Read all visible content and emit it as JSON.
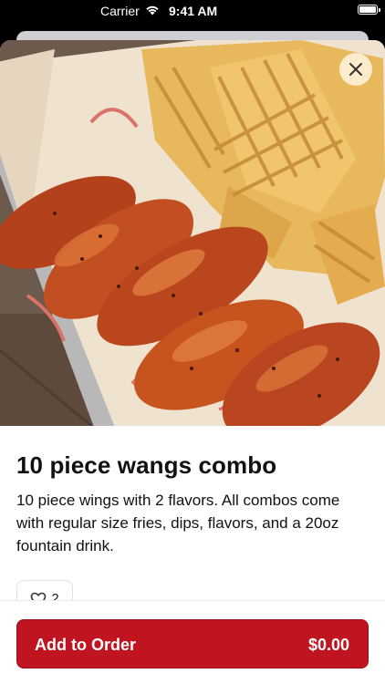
{
  "status_bar": {
    "carrier": "Carrier",
    "time": "9:41 AM",
    "icons": [
      "wifi-icon",
      "battery-icon"
    ]
  },
  "item": {
    "title": "10 piece wangs combo",
    "description": "10 piece wings with 2 flavors. All combos come with regular size fries, dips, flavors, and a 20oz fountain drink.",
    "image_subject": "wings and waffle fries"
  },
  "favorite": {
    "icon": "heart-icon",
    "count": "2"
  },
  "close": {
    "icon": "close-icon"
  },
  "order": {
    "label": "Add to Order",
    "price": "$0.00"
  },
  "colors": {
    "accent": "#c01420",
    "background": "#ffffff",
    "text": "#111111"
  }
}
